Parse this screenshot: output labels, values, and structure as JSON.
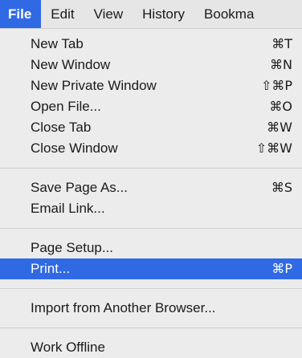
{
  "menubar": {
    "items": [
      {
        "label": "File"
      },
      {
        "label": "Edit"
      },
      {
        "label": "View"
      },
      {
        "label": "History"
      },
      {
        "label": "Bookma"
      }
    ]
  },
  "file_menu": {
    "group1": [
      {
        "label": "New Tab",
        "shortcut": "⌘T"
      },
      {
        "label": "New Window",
        "shortcut": "⌘N"
      },
      {
        "label": "New Private Window",
        "shortcut": "⇧⌘P"
      },
      {
        "label": "Open File...",
        "shortcut": "⌘O"
      },
      {
        "label": "Close Tab",
        "shortcut": "⌘W"
      },
      {
        "label": "Close Window",
        "shortcut": "⇧⌘W"
      }
    ],
    "group2": [
      {
        "label": "Save Page As...",
        "shortcut": "⌘S"
      },
      {
        "label": "Email Link...",
        "shortcut": ""
      }
    ],
    "group3": [
      {
        "label": "Page Setup...",
        "shortcut": ""
      },
      {
        "label": "Print...",
        "shortcut": "⌘P"
      }
    ],
    "group4": [
      {
        "label": "Import from Another Browser...",
        "shortcut": ""
      }
    ],
    "group5": [
      {
        "label": "Work Offline",
        "shortcut": ""
      }
    ]
  },
  "colors": {
    "highlight": "#2f6ae4",
    "menu_background": "#ececec"
  }
}
